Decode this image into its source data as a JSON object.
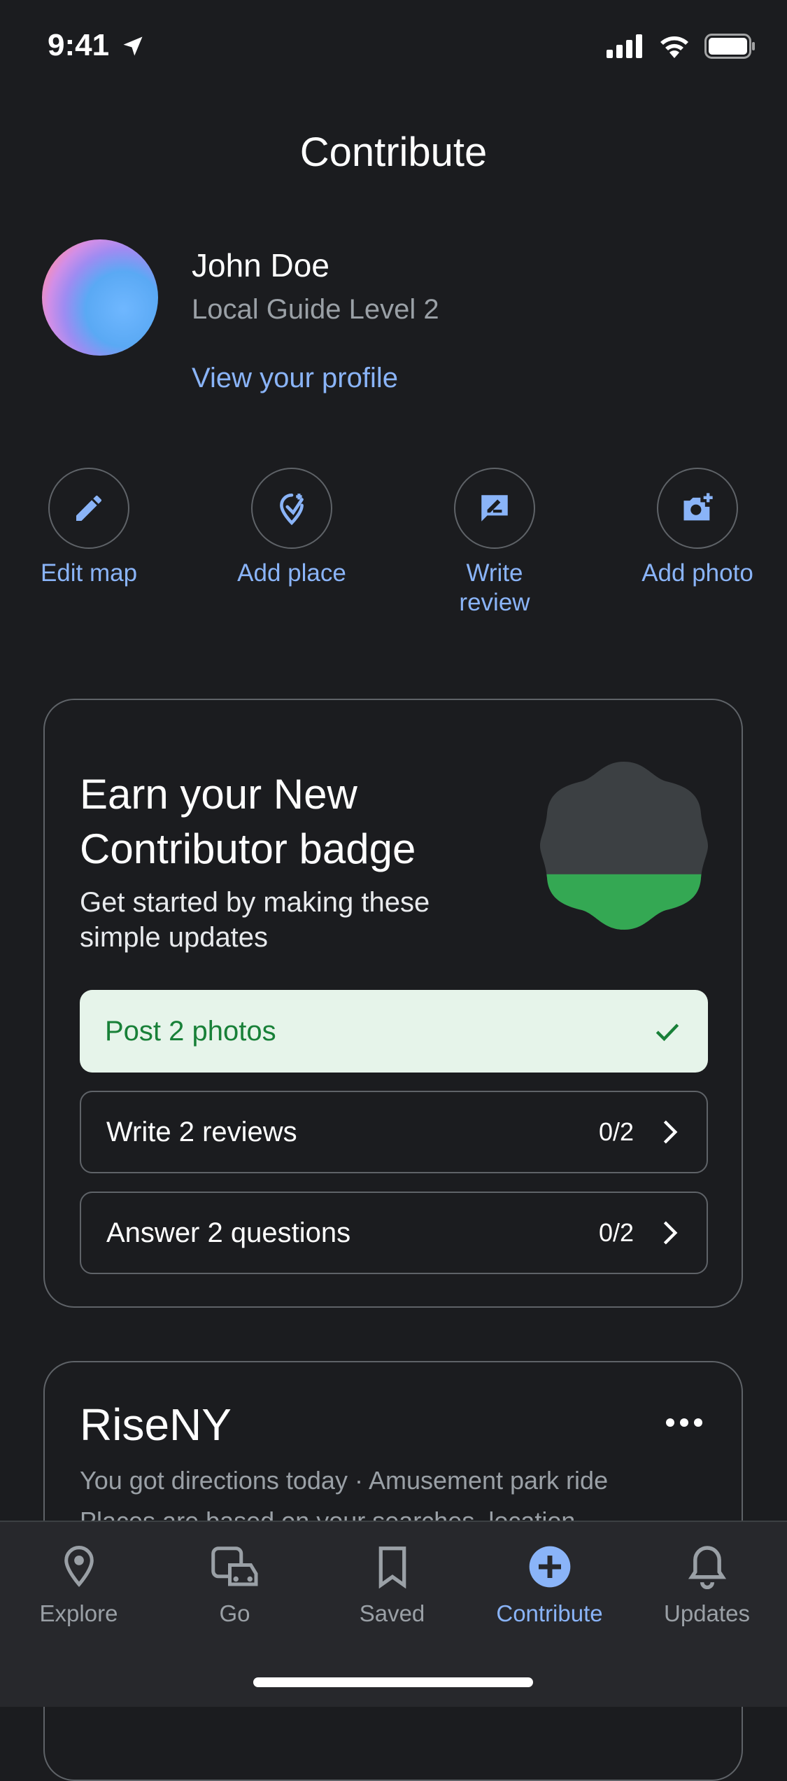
{
  "status_bar": {
    "time": "9:41"
  },
  "page": {
    "title": "Contribute"
  },
  "profile": {
    "name": "John Doe",
    "level": "Local Guide Level 2",
    "view_profile": "View your profile"
  },
  "actions": [
    {
      "label": "Edit map",
      "icon": "pencil-icon"
    },
    {
      "label": "Add place",
      "icon": "add-place-icon"
    },
    {
      "label": "Write review",
      "icon": "review-icon"
    },
    {
      "label": "Add photo",
      "icon": "add-photo-icon"
    }
  ],
  "badge_card": {
    "title": "Earn your New Contributor badge",
    "subtitle": "Get started by making these simple updates",
    "progress_fraction": 0.33,
    "tasks": [
      {
        "label": "Post 2 photos",
        "status": "done"
      },
      {
        "label": "Write 2 reviews",
        "count": "0/2"
      },
      {
        "label": "Answer 2 questions",
        "count": "0/2"
      }
    ]
  },
  "place_card": {
    "title": "RiseNY",
    "subtitle": "You got directions today · Amusement park ride",
    "note": "Places are based on your searches, location"
  },
  "bottom_nav": [
    {
      "label": "Explore",
      "icon": "location-pin-icon"
    },
    {
      "label": "Go",
      "icon": "commute-icon"
    },
    {
      "label": "Saved",
      "icon": "bookmark-icon"
    },
    {
      "label": "Contribute",
      "icon": "add-circle-icon",
      "active": true
    },
    {
      "label": "Updates",
      "icon": "bell-icon"
    }
  ],
  "colors": {
    "background": "#1b1c1f",
    "accent": "#8ab4f8",
    "success": "#188038",
    "success_bg": "#e6f4ea",
    "badge_green": "#34a853"
  }
}
